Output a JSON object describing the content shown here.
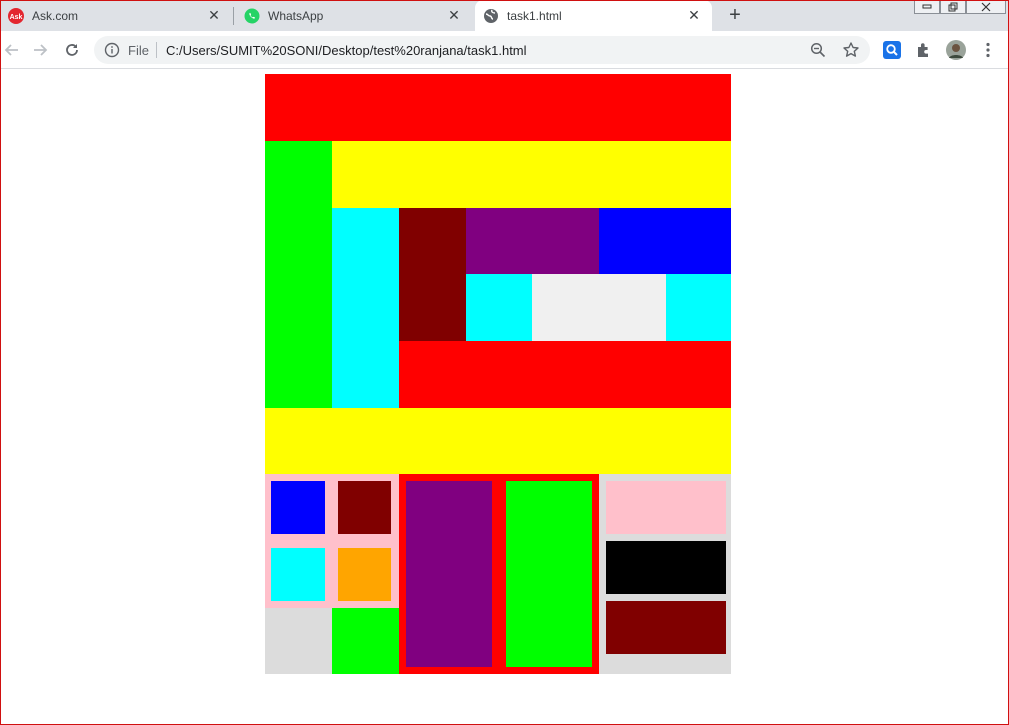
{
  "browser": {
    "tabs": [
      {
        "title": "Ask.com",
        "icon": "ask-icon"
      },
      {
        "title": "WhatsApp",
        "icon": "whatsapp-icon"
      },
      {
        "title": "task1.html",
        "icon": "globe-icon",
        "active": true
      }
    ],
    "close_glyph": "✕",
    "new_tab_glyph": "+",
    "scheme_label": "File",
    "url": "C:/Users/SUMIT%20SONI/Desktop/test%20ranjana/task1.html",
    "window_controls": [
      "minimize",
      "restore",
      "close"
    ]
  },
  "colors": {
    "red": "#ff0000",
    "lime": "#00ff00",
    "yellow": "#ffff00",
    "cyan": "#00ffff",
    "maroon": "#800000",
    "purple": "#800080",
    "blue": "#0000ff",
    "whitesmoke": "#f0f0f0",
    "pink": "#ffc0cb",
    "orange": "#ffa500",
    "gainsboro": "#dcdcdc",
    "black": "#000000"
  }
}
